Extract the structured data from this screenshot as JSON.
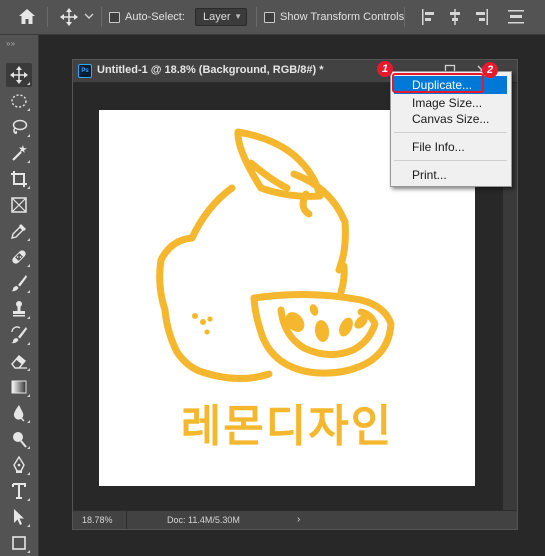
{
  "options_bar": {
    "auto_select_label": "Auto-Select:",
    "layer_select_value": "Layer",
    "show_transform_label": "Show Transform Controls"
  },
  "document": {
    "ps_badge": "Ps",
    "title": "Untitled-1 @ 18.8% (Background, RGB/8#) *",
    "status_zoom": "18.78%",
    "status_doc": "Doc: 11.4M/5.30M",
    "status_arrow": "›"
  },
  "canvas": {
    "korean_text": "레몬디자인",
    "lemon_color": "#f5b72e"
  },
  "context_menu": {
    "items": [
      {
        "label": "Duplicate..."
      },
      {
        "label": "Image Size..."
      },
      {
        "label": "Canvas Size..."
      },
      {
        "label": "File Info..."
      },
      {
        "label": "Print..."
      }
    ]
  },
  "annotations": {
    "step1": "1",
    "step2": "2",
    "highlight_color": "#e8192c"
  }
}
